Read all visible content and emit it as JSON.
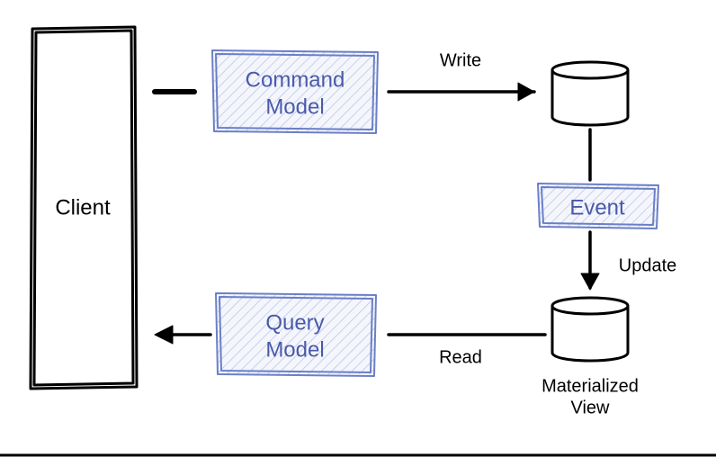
{
  "diagram": {
    "nodes": {
      "client": {
        "label": "Client"
      },
      "command_model": {
        "line1": "Command",
        "line2": "Model"
      },
      "query_model": {
        "line1": "Query",
        "line2": "Model"
      },
      "event": {
        "label": "Event"
      },
      "write_db": {
        "caption": ""
      },
      "read_db": {
        "caption_line1": "Materialized",
        "caption_line2": "View"
      }
    },
    "edges": {
      "client_to_command": {
        "label": ""
      },
      "command_to_writedb": {
        "label": "Write"
      },
      "writedb_to_event": {
        "label": ""
      },
      "event_to_readdb": {
        "label": "Update"
      },
      "readdb_to_query": {
        "label": "Read"
      },
      "query_to_client": {
        "label": ""
      }
    }
  }
}
